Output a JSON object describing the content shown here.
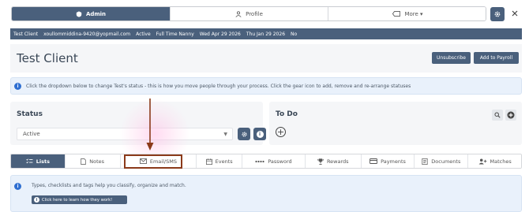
{
  "top_nav": {
    "tabs": [
      {
        "label": "Admin",
        "icon": "badge-icon",
        "active": true
      },
      {
        "label": "Profile",
        "icon": "user-icon",
        "active": false
      },
      {
        "label": "More ▾",
        "icon": "tag-icon",
        "active": false
      }
    ]
  },
  "info_bar": {
    "name": "Test Client",
    "email": "xoullommiddina-9420@yopmail.com",
    "status": "Active",
    "job_type": "Full Time Nanny",
    "date1": "Wed Apr 29 2026",
    "date2": "Thu Jan 29 2026",
    "flag": "No"
  },
  "header": {
    "title": "Test Client",
    "unsubscribe_label": "Unsubscribe",
    "payroll_label": "Add to Payroll"
  },
  "notice": {
    "icon": "info-icon",
    "text": "Click the dropdown below to change Test's status - this is how you move people through your process. Click the gear icon to add, remove and re-arrange statuses"
  },
  "status_panel": {
    "title": "Status",
    "selected": "Active"
  },
  "todo_panel": {
    "title": "To Do",
    "add_symbol": "+"
  },
  "sub_tabs": [
    {
      "label": "Lists",
      "icon": "checklist-icon",
      "active": true
    },
    {
      "label": "Notes",
      "icon": "note-icon",
      "active": false
    },
    {
      "label": "Email/SMS",
      "icon": "envelope-icon",
      "active": false,
      "highlighted": true
    },
    {
      "label": "Events",
      "icon": "calendar-icon",
      "active": false
    },
    {
      "label": "Password",
      "icon": "password-icon",
      "active": false
    },
    {
      "label": "Rewards",
      "icon": "trophy-icon",
      "active": false
    },
    {
      "label": "Payments",
      "icon": "card-icon",
      "active": false
    },
    {
      "label": "Documents",
      "icon": "document-icon",
      "active": false
    },
    {
      "label": "Matches",
      "icon": "users-plus-icon",
      "active": false
    }
  ],
  "lists_panel": {
    "text": "Types, checklists and tags help you classify, organize and match.",
    "learn_label": "Click here to learn how they work!"
  },
  "colors": {
    "primary": "#4a607c",
    "info_bg": "#e9f1fb",
    "highlight": "#8b3a1a"
  }
}
